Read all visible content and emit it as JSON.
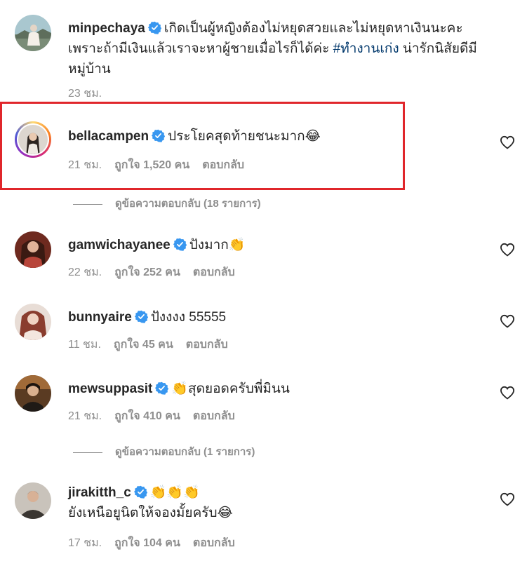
{
  "comments": [
    {
      "username": "minpechaya",
      "text_parts": [
        "เกิดเป็นผู้หญิงต้องไม่หยุดสวยและไม่หยุดหาเงินนะคะ เพราะถ้ามีเงินแล้วเราจะหาผู้ชายเมื่อไรก็ได้ค่ะ ",
        "#ทำงานเก่ง",
        " น่ารักนิสัยดีมีหมู่บ้าน"
      ],
      "time": "23 ชม."
    },
    {
      "username": "bellacampen",
      "text": "ประโยคสุดท้ายชนะมาก😂",
      "time": "21 ชม.",
      "likes": "ถูกใจ 1,520 คน",
      "reply": "ตอบกลับ",
      "view_replies": "ดูข้อความตอบกลับ (18 รายการ)"
    },
    {
      "username": "gamwichayanee",
      "text": "ปังมาก👏",
      "time": "22 ชม.",
      "likes": "ถูกใจ 252 คน",
      "reply": "ตอบกลับ"
    },
    {
      "username": "bunnyaire",
      "text": "ปังงงง 55555",
      "time": "11 ชม.",
      "likes": "ถูกใจ 45 คน",
      "reply": "ตอบกลับ"
    },
    {
      "username": "mewsuppasit",
      "text": "👏สุดยอดครับพี่มินน",
      "time": "21 ชม.",
      "likes": "ถูกใจ 410 คน",
      "reply": "ตอบกลับ",
      "view_replies": "ดูข้อความตอบกลับ (1 รายการ)"
    },
    {
      "username": "jirakitth_c",
      "text_line1": "👏👏👏",
      "text_line2": "ยังเหนือยูนิตให้จองมั้ยครับ😂",
      "time": "17 ชม.",
      "likes": "ถูกใจ 104 คน",
      "reply": "ตอบกลับ"
    }
  ],
  "colors": {
    "verified": "#3897f0",
    "highlight_border": "#e0262b",
    "hashtag": "#00376b",
    "meta": "#8e8e8e"
  },
  "icons": {
    "verified": "verified-badge-icon",
    "like": "heart-icon"
  }
}
